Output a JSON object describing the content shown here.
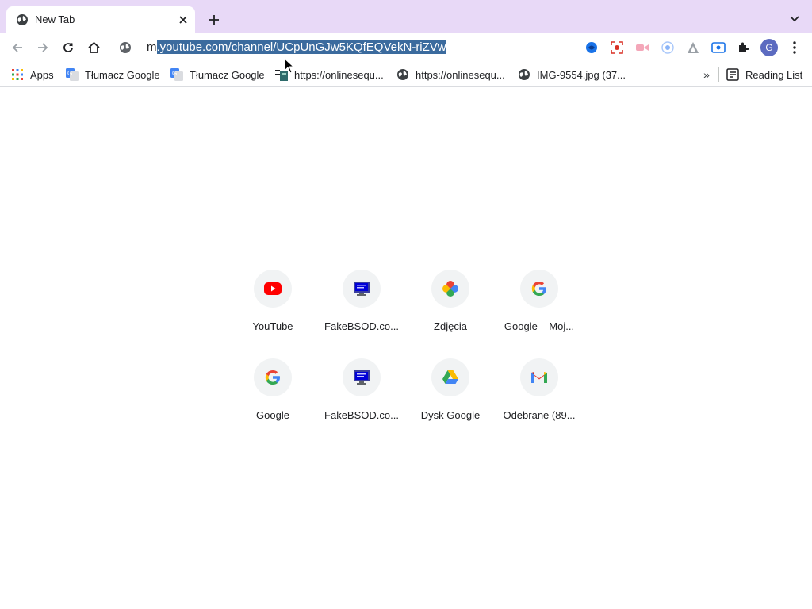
{
  "tab": {
    "title": "New Tab"
  },
  "omnibox": {
    "url_prefix": "m",
    "url_selected": ".youtube.com/channel/UCpUnGJw5KQfEQVekN-riZVw"
  },
  "bookmarks": {
    "items": [
      {
        "label": "Apps",
        "icon": "apps-grid-icon"
      },
      {
        "label": "Tłumacz Google",
        "icon": "google-translate-icon"
      },
      {
        "label": "Tłumacz Google",
        "icon": "google-translate-icon"
      },
      {
        "label": "https://onlinesequ...",
        "icon": "sequencer-icon"
      },
      {
        "label": "https://onlinesequ...",
        "icon": "globe-icon"
      },
      {
        "label": "IMG-9554.jpg (37...",
        "icon": "globe-icon"
      }
    ],
    "more": "»",
    "reading_list": "Reading List"
  },
  "profile": {
    "initial": "G"
  },
  "shortcuts": [
    {
      "label": "YouTube",
      "icon": "youtube-icon"
    },
    {
      "label": "FakeBSOD.co...",
      "icon": "monitor-icon"
    },
    {
      "label": "Zdjęcia",
      "icon": "google-photos-icon"
    },
    {
      "label": "Google – Moj...",
      "icon": "google-g-icon"
    },
    {
      "label": "Google",
      "icon": "google-g-icon"
    },
    {
      "label": "FakeBSOD.co...",
      "icon": "monitor-icon"
    },
    {
      "label": "Dysk Google",
      "icon": "google-drive-icon"
    },
    {
      "label": "Odebrane (89...",
      "icon": "gmail-icon"
    }
  ],
  "colors": {
    "tabstrip_bg": "#e8d9f7",
    "selection_bg": "#3b6b9e",
    "avatar_bg": "#5c6bc0"
  }
}
